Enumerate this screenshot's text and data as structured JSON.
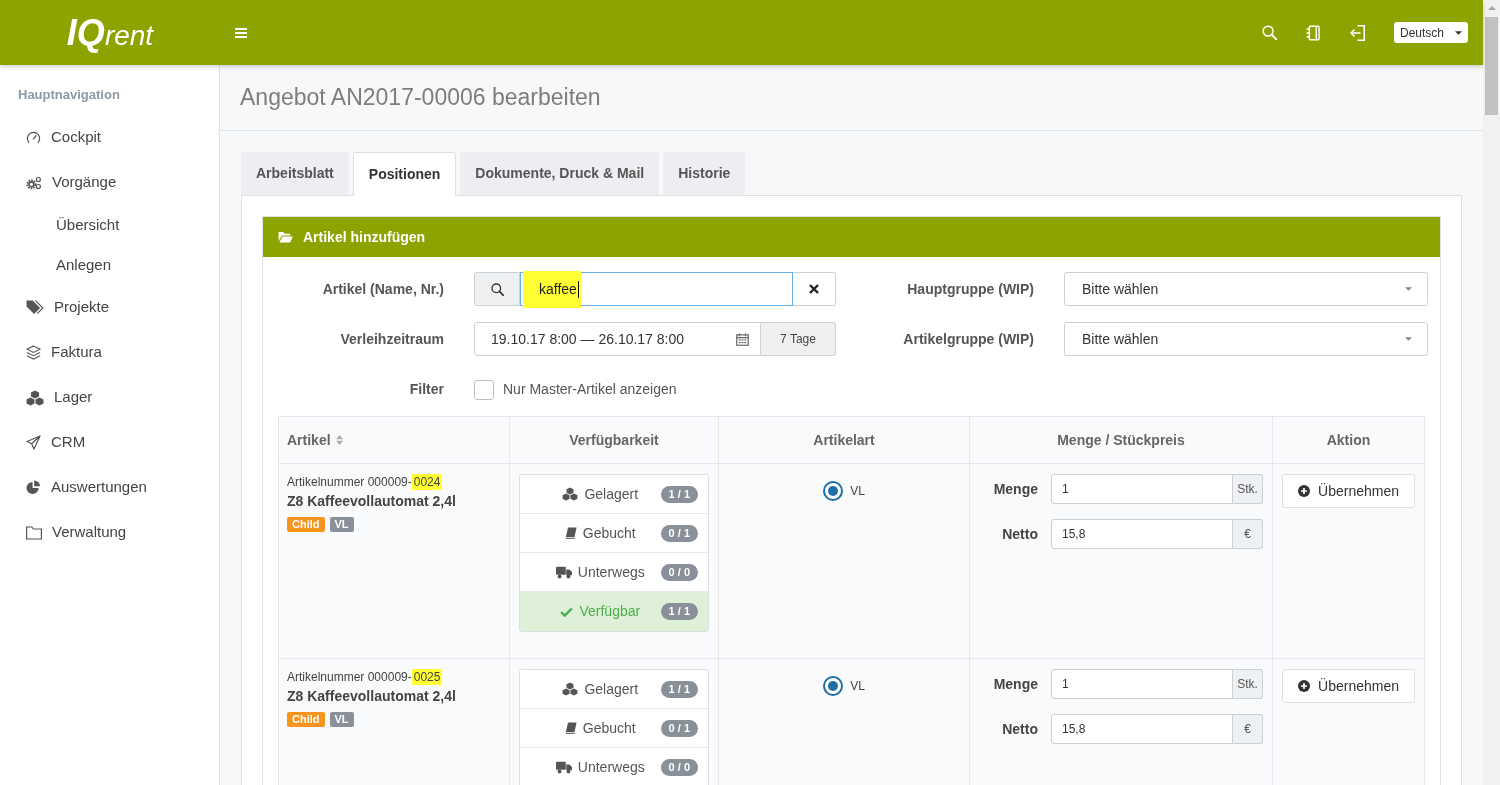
{
  "topbar": {
    "logo_mark": "IQ",
    "logo_text": "rent",
    "language": "Deutsch"
  },
  "sidebar": {
    "heading": "Hauptnavigation",
    "items": [
      {
        "label": "Cockpit"
      },
      {
        "label": "Vorgänge",
        "children": [
          {
            "label": "Übersicht"
          },
          {
            "label": "Anlegen"
          }
        ]
      },
      {
        "label": "Projekte"
      },
      {
        "label": "Faktura"
      },
      {
        "label": "Lager"
      },
      {
        "label": "CRM"
      },
      {
        "label": "Auswertungen"
      },
      {
        "label": "Verwaltung"
      }
    ]
  },
  "page": {
    "title": "Angebot AN2017-00006 bearbeiten"
  },
  "tabs": [
    {
      "label": "Arbeitsblatt",
      "selected": false
    },
    {
      "label": "Positionen",
      "selected": true
    },
    {
      "label": "Dokumente, Druck & Mail",
      "selected": false
    },
    {
      "label": "Historie",
      "selected": false
    }
  ],
  "panel": {
    "title": "Artikel hinzufügen",
    "form": {
      "article_label": "Artikel (Name, Nr.)",
      "search": {
        "value": "kaffee",
        "focused": true,
        "highlighted": true
      },
      "period_label": "Verleihzeitraum",
      "period_value": "19.10.17 8:00 — 26.10.17 8:00",
      "period_days": "7 Tage",
      "filter_label": "Filter",
      "master_only": {
        "label": "Nur Master-Artikel anzeigen",
        "checked": false
      },
      "main_group": {
        "label": "Hauptgruppe (WIP)",
        "value": "Bitte wählen"
      },
      "article_group": {
        "label": "Artikelgruppe (WIP)",
        "value": "Bitte wählen"
      }
    },
    "table": {
      "columns": [
        {
          "label": "Artikel",
          "sortable": true
        },
        {
          "label": "Verfügbarkeit",
          "sortable": false
        },
        {
          "label": "Artikelart",
          "sortable": false
        },
        {
          "label": "Menge / Stückpreis",
          "sortable": false
        },
        {
          "label": "Aktion",
          "sortable": false
        }
      ],
      "rows": [
        {
          "number": "Artikelnummer 000009-",
          "number_highlight": "0024",
          "name": "Z8 Kaffeevollautomat 2,4l",
          "tags": [
            {
              "label": "Child",
              "color": "#f7941d"
            },
            {
              "label": "VL",
              "color": "#8a9099"
            }
          ],
          "availability": [
            {
              "kind": "stored",
              "label": "Gelagert",
              "count": "1 / 1"
            },
            {
              "kind": "booked",
              "label": "Gebucht",
              "count": "0 / 1"
            },
            {
              "kind": "transit",
              "label": "Unterwegs",
              "count": "0 / 0"
            },
            {
              "kind": "available",
              "label": "Verfügbar",
              "count": "1 / 1"
            }
          ],
          "types": [
            {
              "label": "VL",
              "selected": true
            }
          ],
          "quantity_label": "Menge",
          "quantity": "1",
          "quantity_unit": "Stk.",
          "net_label": "Netto",
          "net": "15,8",
          "currency": "€",
          "action": "Übernehmen"
        },
        {
          "number": "Artikelnummer 000009-",
          "number_highlight": "0025",
          "name": "Z8 Kaffeevollautomat 2,4l",
          "tags": [
            {
              "label": "Child",
              "color": "#f7941d"
            },
            {
              "label": "VL",
              "color": "#8a9099"
            }
          ],
          "availability": [
            {
              "kind": "stored",
              "label": "Gelagert",
              "count": "1 / 1"
            },
            {
              "kind": "booked",
              "label": "Gebucht",
              "count": "0 / 1"
            },
            {
              "kind": "transit",
              "label": "Unterwegs",
              "count": "0 / 0"
            }
          ],
          "types": [
            {
              "label": "VL",
              "selected": true
            }
          ],
          "quantity_label": "Menge",
          "quantity": "1",
          "quantity_unit": "Stk.",
          "net_label": "Netto",
          "net": "15,8",
          "currency": "€",
          "action": "Übernehmen"
        }
      ]
    }
  }
}
